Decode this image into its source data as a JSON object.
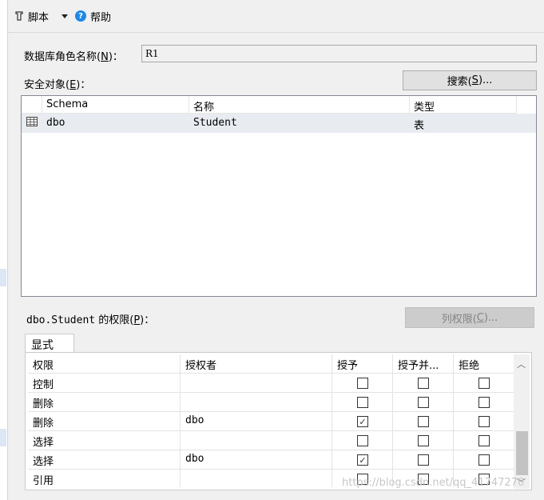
{
  "toolbar": {
    "script_label": "脚本",
    "help_label": "帮助"
  },
  "role": {
    "label_prefix": "数据库角色名称(",
    "label_hotkey": "N",
    "label_suffix": ")：",
    "name_value": "R1"
  },
  "securables": {
    "label_prefix": "安全对象(",
    "label_hotkey": "E",
    "label_suffix": ")：",
    "search_prefix": "搜索(",
    "search_hotkey": "S",
    "search_suffix": ")...",
    "columns": [
      "Schema",
      "名称",
      "类型"
    ],
    "rows": [
      {
        "schema": "dbo",
        "name": "Student",
        "type": "表"
      }
    ]
  },
  "permissions": {
    "label_object": "dbo.Student",
    "label_prefix": " 的权限(",
    "label_hotkey": "P",
    "label_suffix": ")：",
    "column_perm_prefix": "列权限(",
    "column_perm_hotkey": "C",
    "column_perm_suffix": ")...",
    "tab_label": "显式",
    "columns": [
      "权限",
      "授权者",
      "授予",
      "授予并...",
      "拒绝"
    ],
    "rows": [
      {
        "permission": "控制",
        "grantor": "",
        "grant": false,
        "with_grant": false,
        "deny": false
      },
      {
        "permission": "删除",
        "grantor": "",
        "grant": false,
        "with_grant": false,
        "deny": false
      },
      {
        "permission": "删除",
        "grantor": "dbo",
        "grant": true,
        "with_grant": false,
        "deny": false
      },
      {
        "permission": "选择",
        "grantor": "",
        "grant": false,
        "with_grant": false,
        "deny": false
      },
      {
        "permission": "选择",
        "grantor": "dbo",
        "grant": true,
        "with_grant": false,
        "deny": false
      },
      {
        "permission": "引用",
        "grantor": "",
        "grant": false,
        "with_grant": false,
        "deny": false
      }
    ]
  },
  "watermark": "https://blog.csdn.net/qq_41747270"
}
